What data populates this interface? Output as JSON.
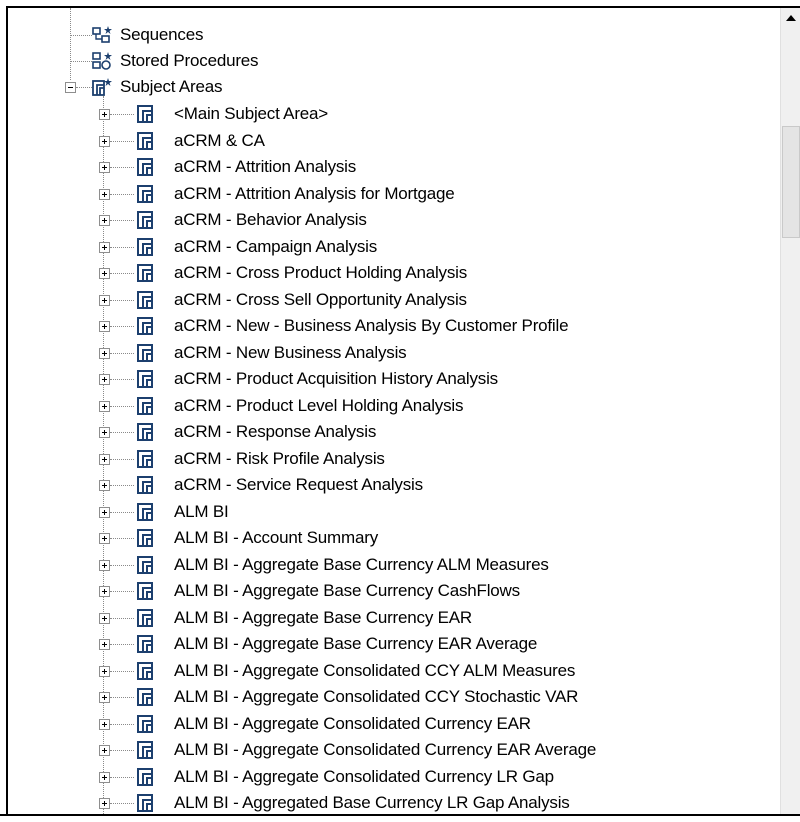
{
  "tree": {
    "top_items": [
      {
        "label": "Sequences",
        "icon": "sequence-icon"
      },
      {
        "label": "Stored Procedures",
        "icon": "stored-procedure-icon"
      }
    ],
    "subject_areas": {
      "label": "Subject Areas",
      "icon": "subject-areas-icon",
      "expanded": true,
      "children": [
        "<Main Subject Area>",
        "aCRM & CA",
        "aCRM - Attrition Analysis",
        "aCRM - Attrition Analysis for Mortgage",
        "aCRM - Behavior Analysis",
        "aCRM - Campaign Analysis",
        "aCRM - Cross Product Holding Analysis",
        "aCRM - Cross Sell Opportunity Analysis",
        "aCRM - New - Business Analysis By Customer Profile",
        "aCRM - New Business Analysis",
        "aCRM - Product Acquisition History Analysis",
        "aCRM - Product Level Holding Analysis",
        "aCRM - Response Analysis",
        "aCRM - Risk Profile Analysis",
        "aCRM - Service Request Analysis",
        "ALM BI",
        "ALM BI - Account Summary",
        "ALM BI - Aggregate Base Currency ALM Measures",
        "ALM BI - Aggregate Base Currency CashFlows",
        "ALM BI - Aggregate Base Currency EAR",
        "ALM BI - Aggregate Base Currency EAR Average",
        "ALM BI - Aggregate Consolidated  CCY ALM Measures",
        "ALM BI - Aggregate Consolidated CCY Stochastic VAR",
        "ALM BI - Aggregate Consolidated Currency EAR",
        "ALM BI - Aggregate Consolidated Currency EAR Average",
        "ALM BI - Aggregate Consolidated Currency LR Gap",
        "ALM BI - Aggregated Base Currency LR Gap Analysis"
      ]
    }
  },
  "colors": {
    "icon_blue": "#1c3f6e",
    "tree_line": "#8a8a8a"
  }
}
